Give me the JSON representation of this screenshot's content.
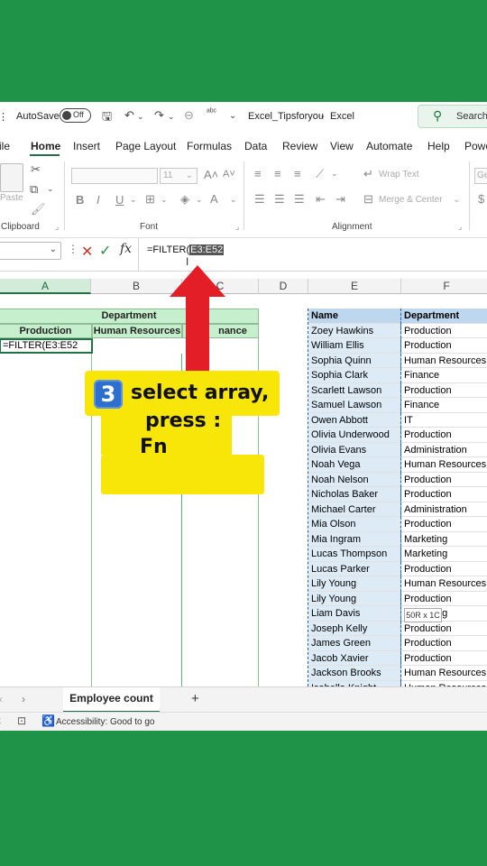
{
  "titlebar": {
    "autosave_label": "AutoSave",
    "autosave_state": "Off",
    "filename": "Excel_Tipsforyou",
    "separator": "-",
    "app_name": "Excel",
    "search_placeholder": "Search"
  },
  "tabs": [
    "ile",
    "Home",
    "Insert",
    "Page Layout",
    "Formulas",
    "Data",
    "Review",
    "View",
    "Automate",
    "Help",
    "Powe"
  ],
  "ribbon": {
    "paste_label": "Paste",
    "clipboard_label": "Clipboard",
    "font_label": "Font",
    "font_size": "11",
    "alignment_label": "Alignment",
    "wrap_text": "Wrap Text",
    "merge_center": "Merge & Center",
    "number_format_partial": "Ge"
  },
  "formula_bar": {
    "formula_prefix": "=FILTER(",
    "formula_selected": "E3:E52"
  },
  "columns": [
    "A",
    "B",
    "C",
    "D",
    "E",
    "F"
  ],
  "left_table": {
    "department_header": "Department",
    "sub_headers": [
      "Production",
      "Human Resources",
      "Finance"
    ],
    "visible_finance_text": "nance",
    "edit_cell": "=FILTER(E3:E52"
  },
  "right_table": {
    "headers": [
      "Name",
      "Department"
    ],
    "rows": [
      [
        "Zoey Hawkins",
        "Production"
      ],
      [
        "William Ellis",
        "Production"
      ],
      [
        "Sophia Quinn",
        "Human Resources"
      ],
      [
        "Sophia Clark",
        "Finance"
      ],
      [
        "Scarlett Lawson",
        "Production"
      ],
      [
        "Samuel Lawson",
        "Finance"
      ],
      [
        "Owen Abbott",
        "IT"
      ],
      [
        "Olivia Underwood",
        "Production"
      ],
      [
        "Olivia Evans",
        "Administration"
      ],
      [
        "Noah Vega",
        "Human Resources"
      ],
      [
        "Noah Nelson",
        "Production"
      ],
      [
        "Nicholas Baker",
        "Production"
      ],
      [
        "Michael Carter",
        "Administration"
      ],
      [
        "Mia Olson",
        "Production"
      ],
      [
        "Mia Ingram",
        "Marketing"
      ],
      [
        "Lucas Thompson",
        "Marketing"
      ],
      [
        "Lucas Parker",
        "Production"
      ],
      [
        "Lily Young",
        "Human Resources"
      ],
      [
        "Lily Young",
        "Production"
      ],
      [
        "Liam Davis",
        "Marketing"
      ],
      [
        "Joseph Kelly",
        "Production"
      ],
      [
        "James Green",
        "Production"
      ],
      [
        "Jacob Xavier",
        "Production"
      ],
      [
        "Jackson Brooks",
        "Human Resources"
      ],
      [
        "Isabella Knight",
        "Human Resources"
      ]
    ]
  },
  "selection_size": "50R x 1C",
  "sheet_tab": "Employee count",
  "add_sheet": "+",
  "status": {
    "accessibility": "Accessibility: Good to go"
  },
  "callout": {
    "step": "3",
    "line1": "select array,",
    "line2": "press :",
    "line3": "Fn"
  },
  "colors": {
    "background_green": "#1f9448",
    "header_green": "#c6efce",
    "callout_yellow": "#f8e608",
    "arrow_red": "#e41e26",
    "name_col_blue": "#ddebf7"
  }
}
